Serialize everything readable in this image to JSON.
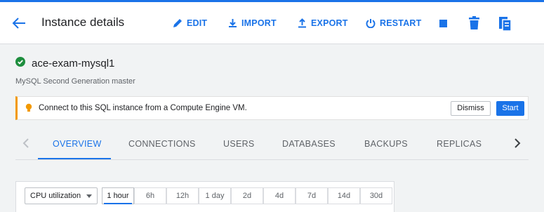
{
  "header": {
    "title": "Instance details",
    "actions": {
      "edit": "EDIT",
      "import": "IMPORT",
      "export": "EXPORT",
      "restart": "RESTART"
    },
    "icons": [
      "back-arrow-icon",
      "edit-pencil-icon",
      "import-icon",
      "export-icon",
      "restart-power-icon",
      "stop-square-icon",
      "delete-trash-icon",
      "clone-icon"
    ]
  },
  "instance": {
    "name": "ace-exam-mysql1",
    "subtitle": "MySQL Second Generation master",
    "status_icon": "check-circle-icon",
    "status_color": "#1e8e3e"
  },
  "banner": {
    "message": "Connect to this SQL instance from a Compute Engine VM.",
    "icon": "lightbulb-icon",
    "dismiss": "Dismiss",
    "start": "Start"
  },
  "tabs": {
    "items": [
      "OVERVIEW",
      "CONNECTIONS",
      "USERS",
      "DATABASES",
      "BACKUPS",
      "REPLICAS"
    ],
    "active": "OVERVIEW"
  },
  "chart_controls": {
    "metric": "CPU utilization",
    "ranges": [
      "1 hour",
      "6h",
      "12h",
      "1 day",
      "2d",
      "4d",
      "7d",
      "14d",
      "30d"
    ],
    "active_range": "1 hour"
  },
  "colors": {
    "accent": "#1a73e8",
    "warning": "#f29900",
    "success": "#1e8e3e"
  }
}
